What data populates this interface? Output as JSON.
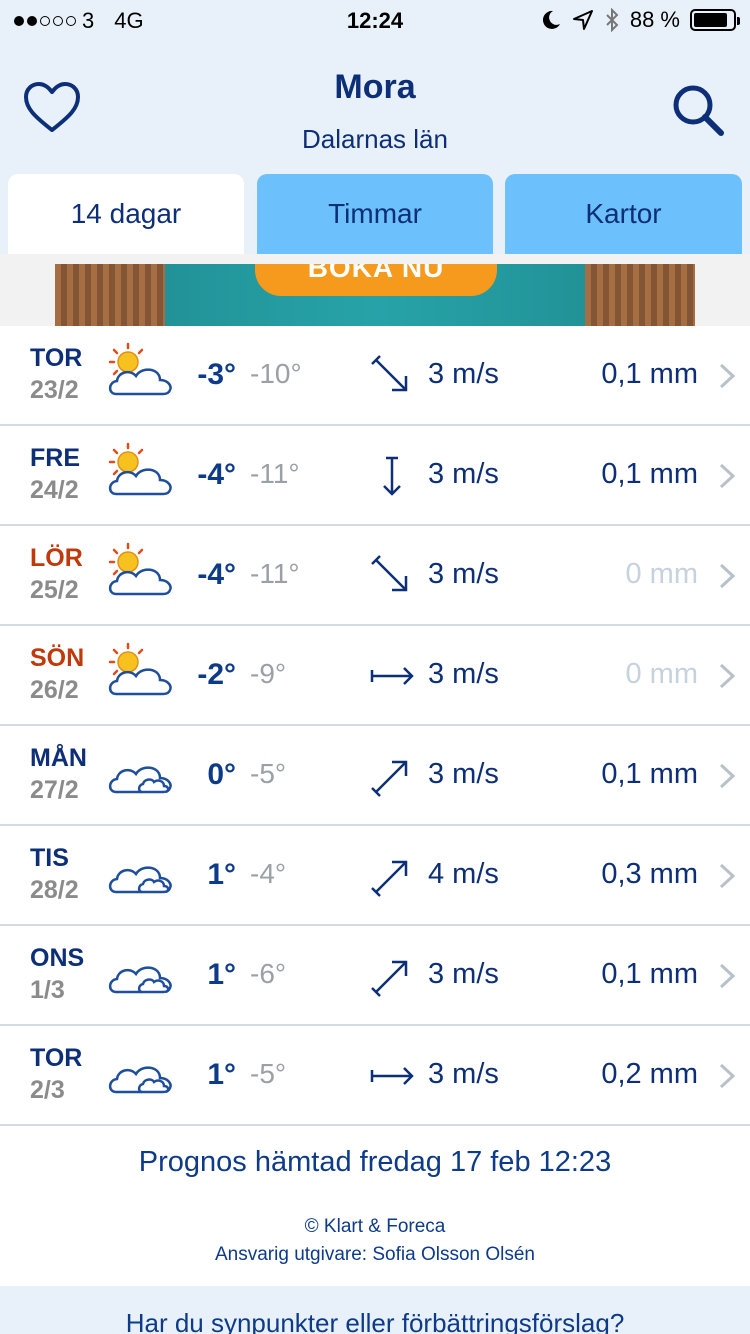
{
  "status_bar": {
    "carrier": "3",
    "network": "4G",
    "time": "12:24",
    "battery": "88 %",
    "battery_level": 0.88,
    "signal_bars_filled": 2,
    "signal_bars_total": 5
  },
  "header": {
    "city": "Mora",
    "region": "Dalarnas län"
  },
  "tabs": [
    {
      "label": "14 dagar",
      "active": true
    },
    {
      "label": "Timmar",
      "active": false
    },
    {
      "label": "Kartor",
      "active": false
    }
  ],
  "ad": {
    "button_text": "BOKA NU"
  },
  "forecast": [
    {
      "day": "TOR",
      "date": "23/2",
      "icon": "partly-sunny-icon",
      "tmax": "-3°",
      "tmin": "-10°",
      "wind_dir": "arrow-down-right-icon",
      "wind": "3 m/s",
      "rain": "0,1 mm",
      "weekend": false,
      "rain_zero": false
    },
    {
      "day": "FRE",
      "date": "24/2",
      "icon": "partly-sunny-icon",
      "tmax": "-4°",
      "tmin": "-11°",
      "wind_dir": "arrow-down-icon",
      "wind": "3 m/s",
      "rain": "0,1 mm",
      "weekend": false,
      "rain_zero": false
    },
    {
      "day": "LÖR",
      "date": "25/2",
      "icon": "partly-sunny-icon",
      "tmax": "-4°",
      "tmin": "-11°",
      "wind_dir": "arrow-down-right-icon",
      "wind": "3 m/s",
      "rain": "0 mm",
      "weekend": true,
      "rain_zero": true
    },
    {
      "day": "SÖN",
      "date": "26/2",
      "icon": "partly-sunny-icon",
      "tmax": "-2°",
      "tmin": "-9°",
      "wind_dir": "arrow-right-icon",
      "wind": "3 m/s",
      "rain": "0 mm",
      "weekend": true,
      "rain_zero": true
    },
    {
      "day": "MÅN",
      "date": "27/2",
      "icon": "cloud-icon",
      "tmax": "0°",
      "tmin": "-5°",
      "wind_dir": "arrow-up-right-icon",
      "wind": "3 m/s",
      "rain": "0,1 mm",
      "weekend": false,
      "rain_zero": false
    },
    {
      "day": "TIS",
      "date": "28/2",
      "icon": "cloud-icon",
      "tmax": "1°",
      "tmin": "-4°",
      "wind_dir": "arrow-up-right-icon",
      "wind": "4 m/s",
      "rain": "0,3 mm",
      "weekend": false,
      "rain_zero": false
    },
    {
      "day": "ONS",
      "date": "1/3",
      "icon": "cloud-icon",
      "tmax": "1°",
      "tmin": "-6°",
      "wind_dir": "arrow-up-right-icon",
      "wind": "3 m/s",
      "rain": "0,1 mm",
      "weekend": false,
      "rain_zero": false
    },
    {
      "day": "TOR",
      "date": "2/3",
      "icon": "cloud-icon",
      "tmax": "1°",
      "tmin": "-5°",
      "wind_dir": "arrow-right-icon",
      "wind": "3 m/s",
      "rain": "0,2 mm",
      "weekend": false,
      "rain_zero": false
    }
  ],
  "footer": {
    "updated": "Prognos hämtad fredag 17 feb 12:23",
    "copyright": "© Klart & Foreca",
    "publisher": "Ansvarig utgivare: Sofia Olsson Olsén",
    "feedback": "Har du synpunkter eller förbättringsförslag?"
  },
  "colors": {
    "primary": "#0d2f78",
    "weekend": "#c0390b",
    "tab_inactive": "#6cc0fb",
    "header_bg": "#e8f1f9"
  }
}
